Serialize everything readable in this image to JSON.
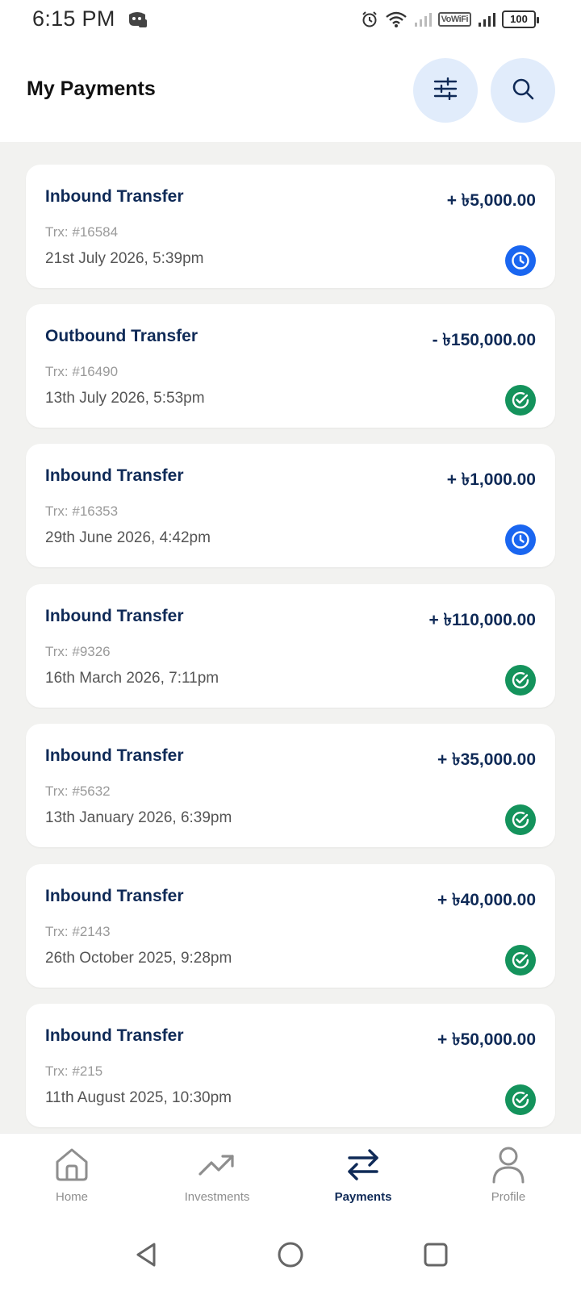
{
  "status_bar": {
    "time": "6:15 PM",
    "vowifi": "VoWiFi",
    "battery": "100",
    "icons": [
      "app-icon",
      "alarm-icon",
      "wifi-icon",
      "signal-icon",
      "vowifi-icon",
      "signal-icon",
      "battery-icon"
    ]
  },
  "header": {
    "title": "My Payments",
    "filter_icon": "sliders-icon",
    "search_icon": "search-icon"
  },
  "transactions": [
    {
      "title": "Inbound Transfer",
      "amount": "+ ৳5,000.00",
      "trx": "Trx: #16584",
      "date": "21st July 2026, 5:39pm",
      "status": "pending"
    },
    {
      "title": "Outbound Transfer",
      "amount": "- ৳150,000.00",
      "trx": "Trx: #16490",
      "date": "13th July 2026, 5:53pm",
      "status": "completed"
    },
    {
      "title": "Inbound Transfer",
      "amount": "+ ৳1,000.00",
      "trx": "Trx: #16353",
      "date": "29th June 2026, 4:42pm",
      "status": "pending"
    },
    {
      "title": "Inbound Transfer",
      "amount": "+ ৳110,000.00",
      "trx": "Trx: #9326",
      "date": "16th March 2026, 7:11pm",
      "status": "completed"
    },
    {
      "title": "Inbound Transfer",
      "amount": "+ ৳35,000.00",
      "trx": "Trx: #5632",
      "date": "13th January 2026, 6:39pm",
      "status": "completed"
    },
    {
      "title": "Inbound Transfer",
      "amount": "+ ৳40,000.00",
      "trx": "Trx: #2143",
      "date": "26th October 2025, 9:28pm",
      "status": "completed"
    },
    {
      "title": "Inbound Transfer",
      "amount": "+ ৳50,000.00",
      "trx": "Trx: #215",
      "date": "11th August 2025, 10:30pm",
      "status": "completed"
    }
  ],
  "status_colors": {
    "pending": "#1a66f0",
    "completed": "#14935c"
  },
  "bottom_nav": {
    "items": [
      {
        "label": "Home",
        "icon": "home-icon",
        "active": false
      },
      {
        "label": "Investments",
        "icon": "trending-up-icon",
        "active": false
      },
      {
        "label": "Payments",
        "icon": "transfer-arrows-icon",
        "active": true
      },
      {
        "label": "Profile",
        "icon": "user-icon",
        "active": false
      }
    ]
  },
  "system_nav": {
    "icons": [
      "back-triangle-icon",
      "home-circle-icon",
      "recents-square-icon"
    ]
  },
  "colors": {
    "primary_text": "#0f2a57",
    "header_button_bg": "#e1ecfb",
    "list_bg": "#f2f2f0"
  }
}
